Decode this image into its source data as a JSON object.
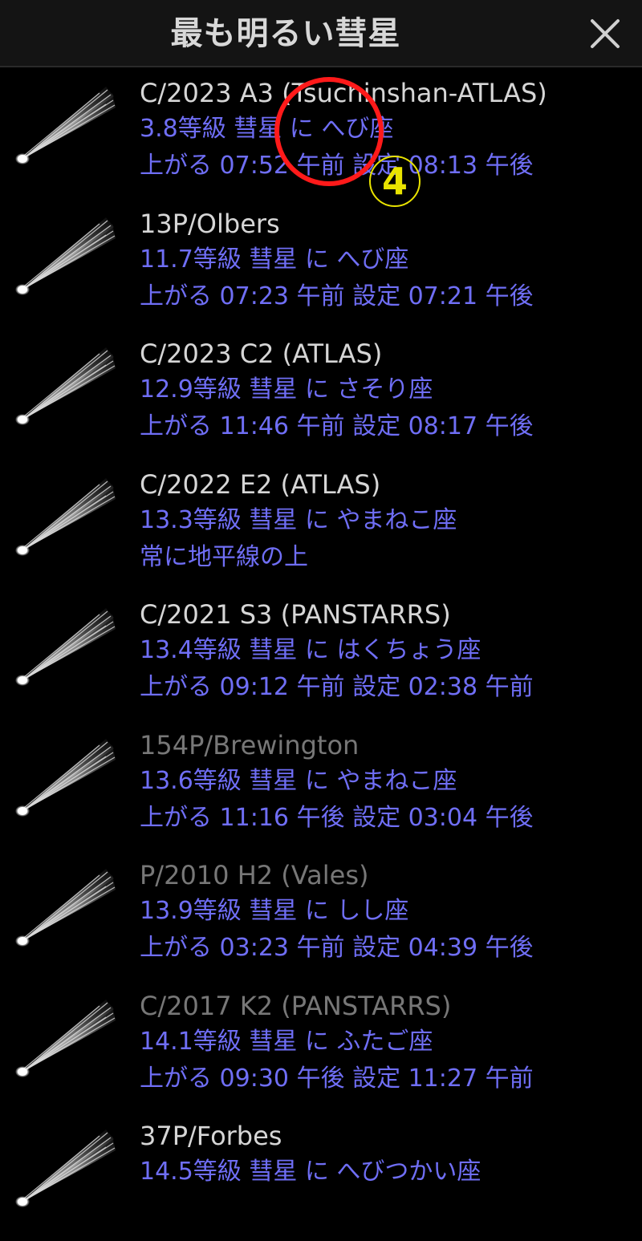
{
  "header": {
    "title": "最も明るい彗星"
  },
  "comets": [
    {
      "name": "C/2023 A3 (Tsuchinshan-ATLAS)",
      "dim": false,
      "magnitude_line": "3.8等級 彗星 に へび座",
      "rise_set_line": "上がる 07:52 午前 設定 08:13 午後"
    },
    {
      "name": "13P/Olbers",
      "dim": false,
      "magnitude_line": "11.7等級 彗星 に へび座",
      "rise_set_line": "上がる 07:23 午前 設定 07:21 午後"
    },
    {
      "name": "C/2023 C2 (ATLAS)",
      "dim": false,
      "magnitude_line": "12.9等級 彗星 に さそり座",
      "rise_set_line": "上がる 11:46 午前 設定 08:17 午後"
    },
    {
      "name": "C/2022 E2 (ATLAS)",
      "dim": false,
      "magnitude_line": "13.3等級 彗星 に やまねこ座",
      "rise_set_line": "常に地平線の上"
    },
    {
      "name": "C/2021 S3 (PANSTARRS)",
      "dim": false,
      "magnitude_line": "13.4等級 彗星 に はくちょう座",
      "rise_set_line": "上がる 09:12 午前 設定 02:38 午前"
    },
    {
      "name": "154P/Brewington",
      "dim": true,
      "magnitude_line": "13.6等級 彗星 に やまねこ座",
      "rise_set_line": "上がる 11:16 午後 設定 03:04 午後"
    },
    {
      "name": "P/2010 H2 (Vales)",
      "dim": true,
      "magnitude_line": "13.9等級 彗星 に しし座",
      "rise_set_line": "上がる 03:23 午前 設定 04:39 午後"
    },
    {
      "name": "C/2017 K2 (PANSTARRS)",
      "dim": true,
      "magnitude_line": "14.1等級 彗星 に ふたご座",
      "rise_set_line": "上がる 09:30 午後 設定 11:27 午前"
    },
    {
      "name": "37P/Forbes",
      "dim": false,
      "magnitude_line": "14.5等級 彗星 に へびつかい座",
      "rise_set_line": ""
    }
  ],
  "annotation": {
    "badge_label": "4"
  },
  "colors": {
    "name_text": "#d6d6d6",
    "name_text_dim": "#777777",
    "detail_text": "#6f6ef5",
    "annotation_circle": "#ff1a1a",
    "annotation_badge": "#e9e300"
  }
}
